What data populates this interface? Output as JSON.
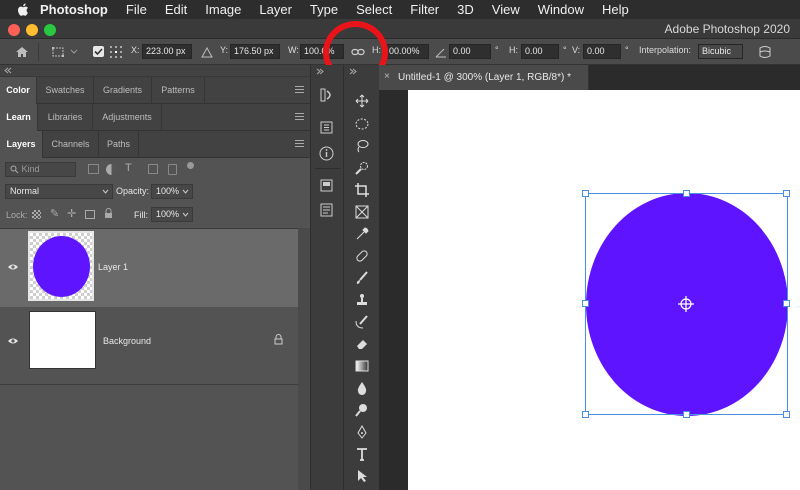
{
  "menubar": {
    "app_name": "Photoshop",
    "items": [
      "File",
      "Edit",
      "Image",
      "Layer",
      "Type",
      "Select",
      "Filter",
      "3D",
      "View",
      "Window",
      "Help"
    ]
  },
  "window": {
    "title": "Adobe Photoshop 2020"
  },
  "options_bar": {
    "x_label": "X:",
    "x_value": "223.00 px",
    "y_label": "Y:",
    "y_value": "176.50 px",
    "w_label": "W:",
    "w_value": "100.0%",
    "h_label": "H:",
    "h_value": "00.00%",
    "angle_value": "0.00",
    "degree_symbol": "°",
    "hskew_label": "H:",
    "hskew_value": "0.00",
    "vskew_label": "V:",
    "vskew_value": "0.00",
    "interp_label": "Interpolation:",
    "interp_value": "Bicubic"
  },
  "panels": {
    "row1_tabs": [
      "Color",
      "Swatches",
      "Gradients",
      "Patterns"
    ],
    "row2_tabs": [
      "Learn",
      "Libraries",
      "Adjustments"
    ],
    "row3_tabs": [
      "Layers",
      "Channels",
      "Paths"
    ],
    "kind_placeholder": "Kind",
    "blend_mode": "Normal",
    "opacity_label": "Opacity:",
    "opacity_value": "100%",
    "lock_label": "Lock:",
    "fill_label": "Fill:",
    "fill_value": "100%"
  },
  "layers": [
    {
      "name": "Layer 1",
      "selected": true
    },
    {
      "name": "Background",
      "selected": false
    }
  ],
  "document": {
    "tab_title": "Untitled-1 @ 300% (Layer 1, RGB/8*) *",
    "shape_color": "#5f14ff"
  },
  "colors": {
    "highlight_circle": "#e8141a",
    "selection_border": "#4a90e2"
  }
}
